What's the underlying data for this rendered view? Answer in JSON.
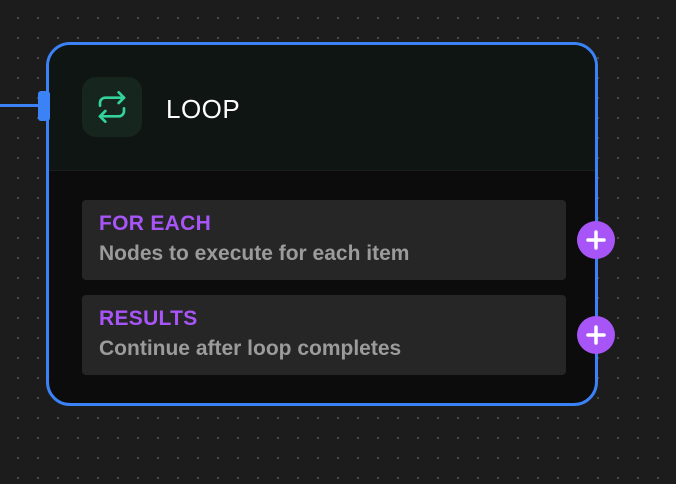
{
  "node": {
    "title": "LOOP",
    "icon": "repeat-icon",
    "accent_color": "#3b82f6",
    "icon_color": "#34d399",
    "handles": [
      {
        "label": "FOR EACH",
        "description": "Nodes to execute for each item",
        "port_icon": "plus-icon"
      },
      {
        "label": "RESULTS",
        "description": "Continue after loop completes",
        "port_icon": "plus-icon"
      }
    ],
    "handle_label_color": "#a855f7",
    "port_color": "#a855f7"
  }
}
